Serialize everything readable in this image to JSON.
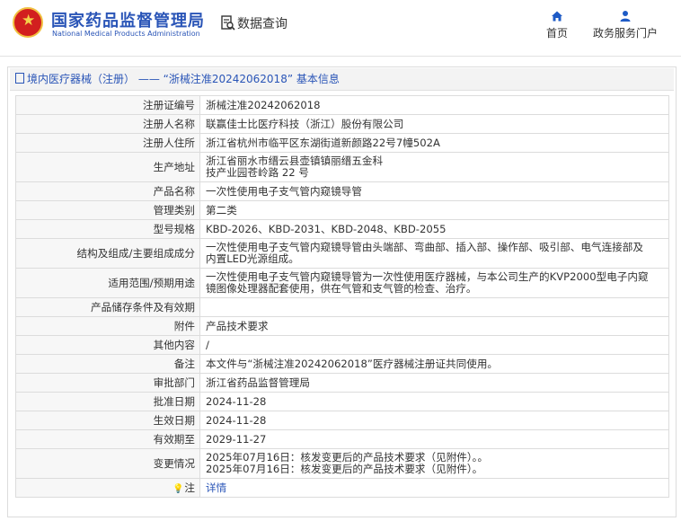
{
  "header": {
    "brand_cn": "国家药品监督管理局",
    "brand_en": "National Medical Products Administration",
    "search_label": "数据查询",
    "nav": [
      {
        "label": "首页",
        "icon": "home-icon"
      },
      {
        "label": "政务服务门户",
        "icon": "user-icon"
      }
    ]
  },
  "panel": {
    "title": "境内医疗器械（注册） —— “浙械注准20242062018” 基本信息"
  },
  "rows": [
    {
      "label": "注册证编号",
      "value": "浙械注准20242062018"
    },
    {
      "label": "注册人名称",
      "value": "联赢佳士比医疗科技（浙江）股份有限公司"
    },
    {
      "label": "注册人住所",
      "value": "浙江省杭州市临平区东湖街道新颜路22号7幢502A"
    },
    {
      "label": "生产地址",
      "value": "浙江省丽水市缙云县壶镇镇丽缙五金科\n技产业园苍岭路 22 号"
    },
    {
      "label": "产品名称",
      "value": "一次性使用电子支气管内窥镜导管"
    },
    {
      "label": "管理类别",
      "value": "第二类"
    },
    {
      "label": "型号规格",
      "value": "KBD-2026、KBD-2031、KBD-2048、KBD-2055"
    },
    {
      "label": "结构及组成/主要组成成分",
      "value": "一次性使用电子支气管内窥镜导管由头端部、弯曲部、插入部、操作部、吸引部、电气连接部及\n内置LED光源组成。"
    },
    {
      "label": "适用范围/预期用途",
      "value": "一次性使用电子支气管内窥镜导管为一次性使用医疗器械，与本公司生产的KVP2000型电子内窥\n镜图像处理器配套使用，供在气管和支气管的检查、治疗。"
    },
    {
      "label": "产品储存条件及有效期",
      "value": ""
    },
    {
      "label": "附件",
      "value": "产品技术要求"
    },
    {
      "label": "其他内容",
      "value": "/"
    },
    {
      "label": "备注",
      "value": "本文件与“浙械注准20242062018”医疗器械注册证共同使用。"
    },
    {
      "label": "审批部门",
      "value": "浙江省药品监督管理局"
    },
    {
      "label": "批准日期",
      "value": "2024-11-28"
    },
    {
      "label": "生效日期",
      "value": "2024-11-28"
    },
    {
      "label": "有效期至",
      "value": "2029-11-27"
    },
    {
      "label": "变更情况",
      "value": "2025年07月16日：核发变更后的产品技术要求（见附件）。。\n2025年07月16日：核发变更后的产品技术要求（见附件）。"
    }
  ],
  "note": {
    "label": "注",
    "link": "详情"
  }
}
